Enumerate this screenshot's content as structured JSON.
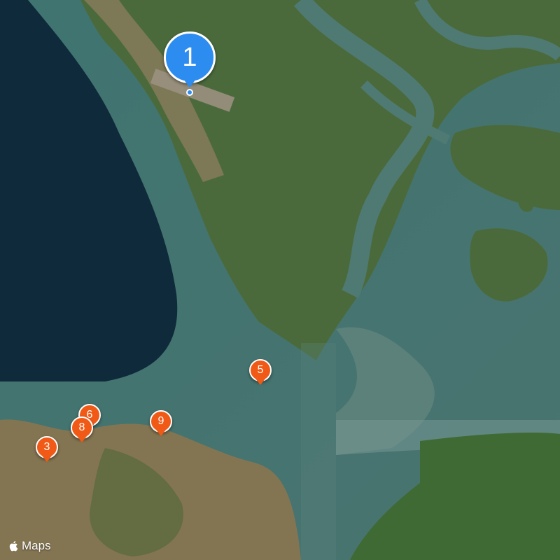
{
  "map": {
    "attribution": "Maps",
    "colors": {
      "deep_sea": "#0f2a3a",
      "shelf_sea": "#3b6a68",
      "estuary": "#4f7a73",
      "land": "#4a6a3a",
      "urban": "#8a7a5a",
      "pin_primary": "#2d8cf0",
      "pin_secondary": "#f05a16"
    },
    "markers": [
      {
        "id": "m1",
        "label": "1",
        "style": "primary"
      },
      {
        "id": "m3",
        "label": "3",
        "style": "secondary"
      },
      {
        "id": "m5",
        "label": "5",
        "style": "secondary"
      },
      {
        "id": "m6",
        "label": "6",
        "style": "secondary"
      },
      {
        "id": "m8",
        "label": "8",
        "style": "secondary"
      },
      {
        "id": "m9",
        "label": "9",
        "style": "secondary"
      }
    ]
  }
}
